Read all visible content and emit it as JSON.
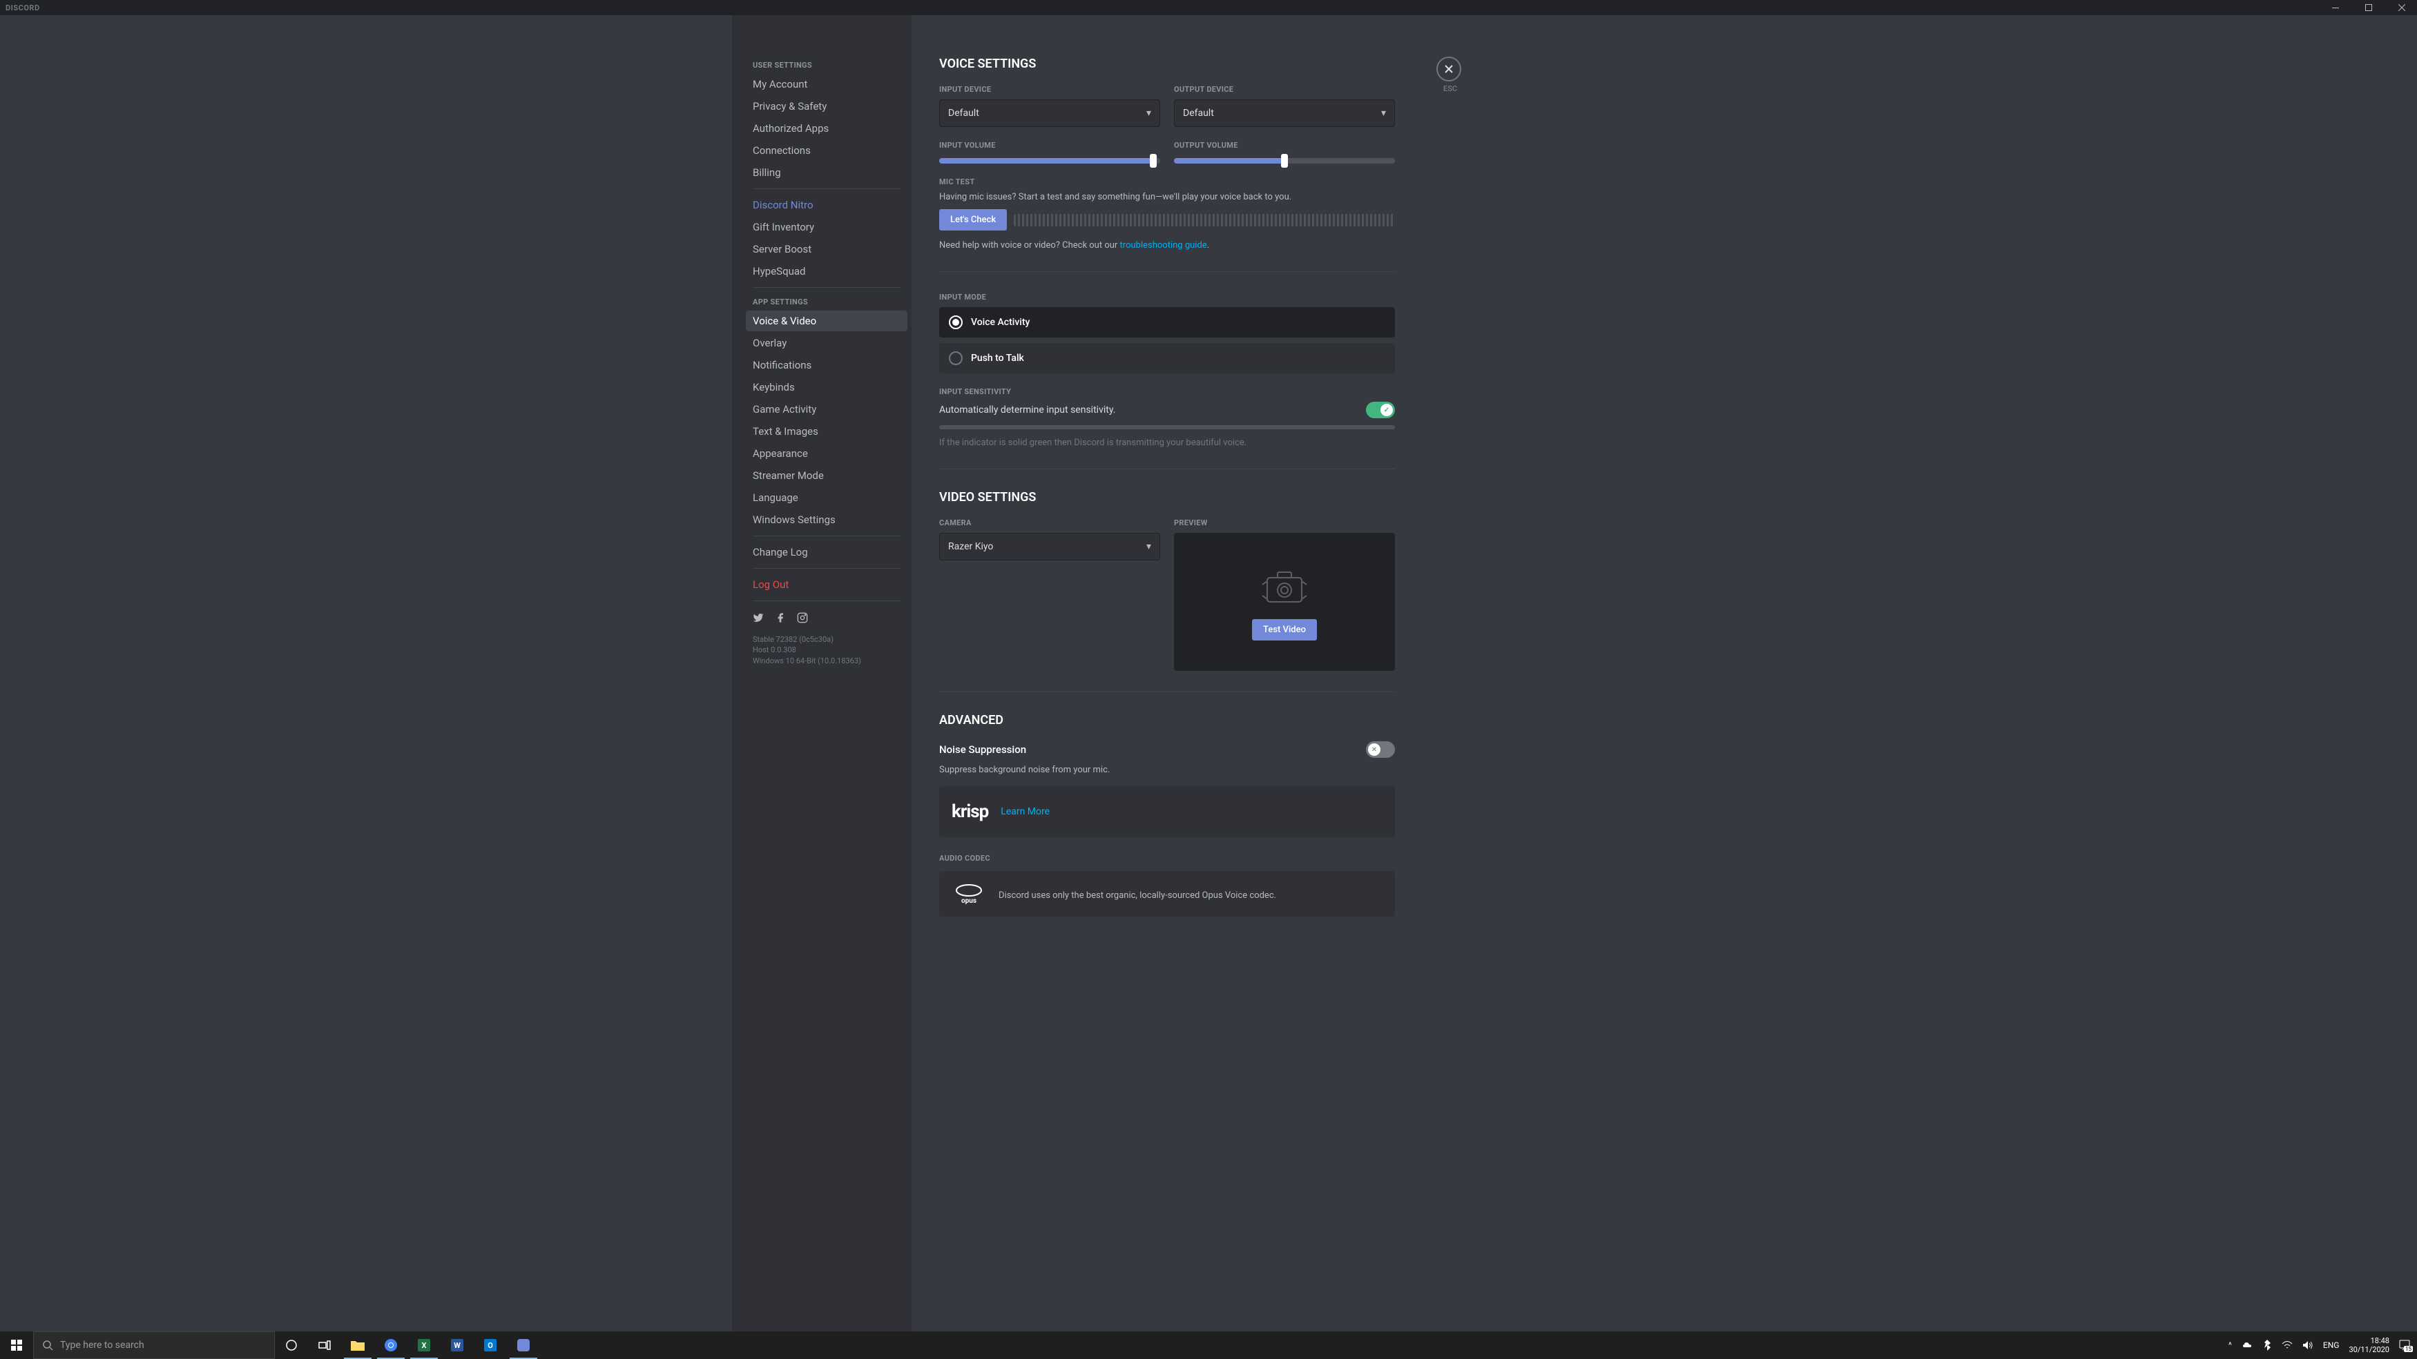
{
  "titlebar": {
    "logo": "DISCORD"
  },
  "sidebar": {
    "userSettingsHeader": "User Settings",
    "appSettingsHeader": "App Settings",
    "items": {
      "myAccount": "My Account",
      "privacy": "Privacy & Safety",
      "authorizedApps": "Authorized Apps",
      "connections": "Connections",
      "billing": "Billing",
      "nitro": "Discord Nitro",
      "giftInventory": "Gift Inventory",
      "serverBoost": "Server Boost",
      "hypesquad": "HypeSquad",
      "voiceVideo": "Voice & Video",
      "overlay": "Overlay",
      "notifications": "Notifications",
      "keybinds": "Keybinds",
      "gameActivity": "Game Activity",
      "textImages": "Text & Images",
      "appearance": "Appearance",
      "streamerMode": "Streamer Mode",
      "language": "Language",
      "windowsSettings": "Windows Settings",
      "changeLog": "Change Log",
      "logOut": "Log Out"
    },
    "version": {
      "line1": "Stable 72382 (0c5c30a)",
      "line2": "Host 0.0.308",
      "line3": "Windows 10 64-Bit (10.0.18363)"
    }
  },
  "close": {
    "esc": "ESC"
  },
  "voice": {
    "title": "Voice Settings",
    "inputDeviceLabel": "Input Device",
    "inputDeviceValue": "Default",
    "outputDeviceLabel": "Output Device",
    "outputDeviceValue": "Default",
    "inputVolumeLabel": "Input Volume",
    "outputVolumeLabel": "Output Volume",
    "inputVolumePct": 97,
    "outputVolumePct": 50,
    "micTestLabel": "Mic Test",
    "micTestDesc": "Having mic issues? Start a test and say something fun—we'll play your voice back to you.",
    "letsCheck": "Let's Check",
    "helpPrefix": "Need help with voice or video? Check out our ",
    "helpLink": "troubleshooting guide",
    "helpSuffix": ".",
    "inputModeLabel": "Input Mode",
    "voiceActivity": "Voice Activity",
    "pushToTalk": "Push to Talk",
    "inputSensitivityLabel": "Input Sensitivity",
    "autoSensitivity": "Automatically determine input sensitivity.",
    "sensitivityHint": "If the indicator is solid green then Discord is transmitting your beautiful voice."
  },
  "video": {
    "title": "Video Settings",
    "cameraLabel": "Camera",
    "cameraValue": "Razer Kiyo",
    "previewLabel": "Preview",
    "testVideo": "Test Video"
  },
  "advanced": {
    "title": "Advanced",
    "noiseSuppressionTitle": "Noise Suppression",
    "noiseSuppressionDesc": "Suppress background noise from your mic.",
    "krispLogo": "krisp",
    "learnMore": "Learn More",
    "audioCodecLabel": "Audio Codec",
    "opusDesc": "Discord uses only the best organic, locally-sourced Opus Voice codec."
  },
  "taskbar": {
    "searchPlaceholder": "Type here to search",
    "lang": "ENG",
    "time": "18:48",
    "date": "30/11/2020",
    "notifCount": "15"
  }
}
